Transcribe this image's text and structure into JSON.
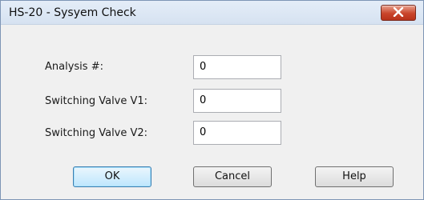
{
  "window": {
    "title": "HS-20 - Sysyem Check"
  },
  "fields": [
    {
      "label": "Analysis #:",
      "value": "0"
    },
    {
      "label": "Switching Valve V1:",
      "value": "0"
    },
    {
      "label": "Switching Valve V2:",
      "value": "0"
    }
  ],
  "buttons": {
    "ok": "OK",
    "cancel": "Cancel",
    "help": "Help"
  },
  "colors": {
    "close_button": "#c9442a",
    "default_button_border": "#3c7fb1"
  },
  "icons": {
    "close": "close-icon"
  }
}
